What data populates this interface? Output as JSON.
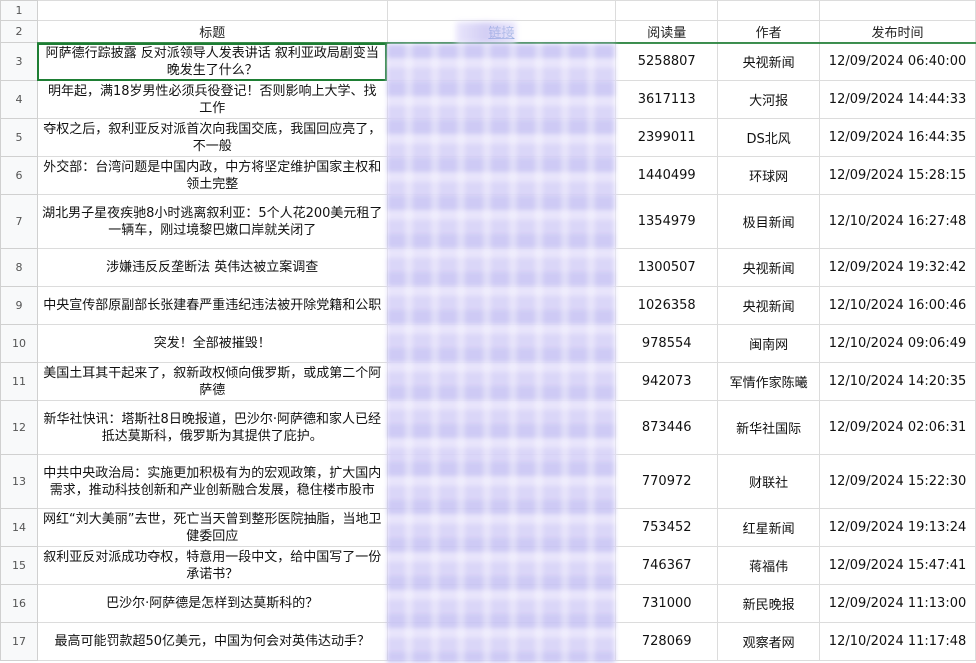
{
  "colors": {
    "selection": "#1e7e34",
    "link": "#1a5fb4",
    "blur": "#c9c5f4",
    "grid": "#dcdcdc"
  },
  "headers": {
    "row_label": "2",
    "title": "标题",
    "link": "链接",
    "reads": "阅读量",
    "author": "作者",
    "published": "发布时间"
  },
  "first_row_label": "1",
  "rows": [
    {
      "n": "3",
      "title": "阿萨德行踪披露 反对派领导人发表讲话 叙利亚政局剧变当晚发生了什么？",
      "reads": "5258807",
      "author": "央视新闻",
      "time": "12/09/2024 06:40:00"
    },
    {
      "n": "4",
      "title": "明年起，满18岁男性必须兵役登记！否则影响上大学、找工作",
      "reads": "3617113",
      "author": "大河报",
      "time": "12/09/2024 14:44:33"
    },
    {
      "n": "5",
      "title": "夺权之后，叙利亚反对派首次向我国交底，我国回应亮了，不一般",
      "reads": "2399011",
      "author": "DS北风",
      "time": "12/09/2024 16:44:35"
    },
    {
      "n": "6",
      "title": "外交部：台湾问题是中国内政，中方将坚定维护国家主权和领土完整",
      "reads": "1440499",
      "author": "环球网",
      "time": "12/09/2024 15:28:15"
    },
    {
      "n": "7",
      "title": "湖北男子星夜疾驰8小时逃离叙利亚：5个人花200美元租了一辆车，刚过境黎巴嫩口岸就关闭了",
      "reads": "1354979",
      "author": "极目新闻",
      "time": "12/10/2024 16:27:48"
    },
    {
      "n": "8",
      "title": "涉嫌违反反垄断法 英伟达被立案调查",
      "reads": "1300507",
      "author": "央视新闻",
      "time": "12/09/2024 19:32:42"
    },
    {
      "n": "9",
      "title": "中央宣传部原副部长张建春严重违纪违法被开除党籍和公职",
      "reads": "1026358",
      "author": "央视新闻",
      "time": "12/10/2024 16:00:46"
    },
    {
      "n": "10",
      "title": "突发！全部被摧毁！",
      "reads": "978554",
      "author": "闽南网",
      "time": "12/10/2024 09:06:49"
    },
    {
      "n": "11",
      "title": "美国土耳其干起来了，叙新政权倾向俄罗斯，或成第二个阿萨德",
      "reads": "942073",
      "author": "军情作家陈曦",
      "time": "12/10/2024 14:20:35"
    },
    {
      "n": "12",
      "title": "新华社快讯：塔斯社8日晚报道，巴沙尔·阿萨德和家人已经抵达莫斯科，俄罗斯为其提供了庇护。",
      "reads": "873446",
      "author": "新华社国际",
      "time": "12/09/2024 02:06:31"
    },
    {
      "n": "13",
      "title": "中共中央政治局：实施更加积极有为的宏观政策，扩大国内需求，推动科技创新和产业创新融合发展，稳住楼市股市",
      "reads": "770972",
      "author": "财联社",
      "time": "12/09/2024 15:22:30"
    },
    {
      "n": "14",
      "title": "网红“刘大美丽”去世，死亡当天曾到整形医院抽脂，当地卫健委回应",
      "reads": "753452",
      "author": "红星新闻",
      "time": "12/09/2024 19:13:24"
    },
    {
      "n": "15",
      "title": "叙利亚反对派成功夺权，特意用一段中文，给中国写了一份承诺书？",
      "reads": "746367",
      "author": "蒋福伟",
      "time": "12/09/2024 15:47:41"
    },
    {
      "n": "16",
      "title": "巴沙尔·阿萨德是怎样到达莫斯科的？",
      "reads": "731000",
      "author": "新民晚报",
      "time": "12/09/2024 11:13:00"
    },
    {
      "n": "17",
      "title": "最高可能罚款超50亿美元，中国为何会对英伟达动手？",
      "reads": "728069",
      "author": "观察者网",
      "time": "12/10/2024 11:17:48"
    }
  ]
}
